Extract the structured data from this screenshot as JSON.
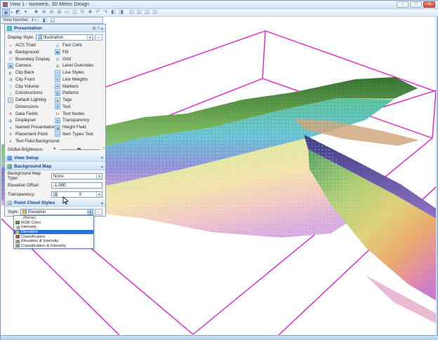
{
  "window": {
    "title": "View 1 - Isometric, 3D Metric Design",
    "minimize_label": "–",
    "maximize_label": "□",
    "close_label": "✕"
  },
  "toolbar": {
    "icons": [
      {
        "name": "view-attributes-icon",
        "glyph": "▣",
        "sel": true
      },
      {
        "name": "view-attributes-caret-icon",
        "glyph": "▾",
        "caret": true
      },
      {
        "name": "view-display-mode-icon",
        "glyph": "◩"
      },
      {
        "name": "adjust-view-brightness-icon",
        "glyph": "✦"
      },
      {
        "name": "separator",
        "sep": true
      },
      {
        "name": "update-view-icon",
        "glyph": "✚"
      },
      {
        "name": "zoom-in-icon",
        "glyph": "⊕"
      },
      {
        "name": "zoom-out-icon",
        "glyph": "⊖"
      },
      {
        "name": "window-area-icon",
        "glyph": "⊞"
      },
      {
        "name": "fit-view-icon",
        "glyph": "▭"
      },
      {
        "name": "copy-view-icon",
        "glyph": "◫"
      },
      {
        "name": "rotate-view-icon",
        "glyph": "↻"
      },
      {
        "name": "pan-view-icon",
        "glyph": "✥"
      },
      {
        "name": "view-previous-icon",
        "glyph": "↶"
      },
      {
        "name": "view-next-icon",
        "glyph": "↷"
      },
      {
        "name": "apply-window-1-icon",
        "glyph": "◧"
      },
      {
        "name": "apply-window-2-icon",
        "glyph": "◨"
      },
      {
        "name": "separator",
        "sep": true
      },
      {
        "name": "clip-volume-icon",
        "glyph": "◰"
      },
      {
        "name": "clip-mask-icon",
        "glyph": "◱"
      },
      {
        "name": "camera-settings-icon",
        "glyph": "◲"
      },
      {
        "name": "navigate-view-icon",
        "glyph": "◳"
      }
    ],
    "view_number_label": "View Number:",
    "view_number_value": "1",
    "view_number_caret": "▾",
    "view_group_icons": [
      {
        "name": "show-view-toggle-icon",
        "glyph": "◧"
      },
      {
        "name": "manage-view-groups-icon",
        "glyph": "◱"
      }
    ]
  },
  "panel": {
    "title": "Presentation",
    "header_icons": [
      {
        "name": "panel-grid-view-icon",
        "glyph": "⊞"
      },
      {
        "name": "panel-list-view-icon",
        "glyph": "≡"
      },
      {
        "name": "panel-collapse-icon",
        "glyph": "▴"
      }
    ],
    "display_style_label": "Display Style:",
    "display_style_value": "Illustration",
    "display_style_caret": "▾",
    "more_button_label": "...",
    "left_items": [
      {
        "label": "ACS Triad",
        "icon": "acs-triad-icon",
        "glyph": "✛",
        "color": "#c07020",
        "enabled": false
      },
      {
        "label": "Background",
        "icon": "background-icon",
        "glyph": "▦",
        "color": "#7090b0",
        "enabled": false
      },
      {
        "label": "Boundary Display",
        "icon": "boundary-display-icon",
        "glyph": "◳",
        "color": "#7090b0",
        "enabled": false
      },
      {
        "label": "Camera",
        "icon": "camera-icon",
        "glyph": "▣",
        "color": "#4878b8",
        "enabled": true
      },
      {
        "label": "Clip Back",
        "icon": "clip-back-icon",
        "glyph": "◧",
        "color": "#8098b0",
        "enabled": false
      },
      {
        "label": "Clip Front",
        "icon": "clip-front-icon",
        "glyph": "◨",
        "color": "#8098b0",
        "enabled": false
      },
      {
        "label": "Clip Volume",
        "icon": "clip-volume-icon",
        "glyph": "◰",
        "color": "#8098b0",
        "enabled": false
      },
      {
        "label": "Constructions",
        "icon": "constructions-icon",
        "glyph": "△",
        "color": "#6888a8",
        "enabled": false
      },
      {
        "label": "Default Lighting",
        "icon": "default-lighting-icon",
        "glyph": "☀",
        "color": "#d8a020",
        "enabled": true
      },
      {
        "label": "Dimensions",
        "icon": "dimensions-icon",
        "glyph": "↔",
        "color": "#3060a0",
        "enabled": false
      },
      {
        "label": "Data Fields",
        "icon": "data-fields-icon",
        "glyph": "A",
        "color": "#c03030",
        "enabled": false
      },
      {
        "label": "Displayset",
        "icon": "displayset-icon",
        "glyph": "▤",
        "color": "#5080b0",
        "enabled": false
      },
      {
        "label": "Named Presentation",
        "icon": "named-presentation-icon",
        "glyph": "★",
        "color": "#8080a0",
        "enabled": false
      },
      {
        "label": "Placement Point",
        "icon": "placement-point-icon",
        "glyph": "✛",
        "color": "#3050a0",
        "enabled": false
      },
      {
        "label": "Text Field Background",
        "icon": "text-field-background-icon",
        "glyph": "a",
        "color": "#444444",
        "enabled": false
      }
    ],
    "right_items": [
      {
        "label": "Fast Cells",
        "icon": "fast-cells-icon",
        "glyph": "⊞",
        "color": "#80a0c8",
        "enabled": false
      },
      {
        "label": "Fill",
        "icon": "fill-icon",
        "glyph": "◼",
        "color": "#3878c0",
        "enabled": true
      },
      {
        "label": "Grid",
        "icon": "grid-icon",
        "glyph": "▦",
        "color": "#9ab0c8",
        "enabled": false
      },
      {
        "label": "Level Overrides",
        "icon": "level-overrides-icon",
        "glyph": "▤",
        "color": "#50a050",
        "enabled": false
      },
      {
        "label": "Line Styles",
        "icon": "line-styles-icon",
        "glyph": "≈",
        "color": "#3060a0",
        "enabled": true
      },
      {
        "label": "Line Weights",
        "icon": "line-weights-icon",
        "glyph": "≡",
        "color": "#204880",
        "enabled": true
      },
      {
        "label": "Markers",
        "icon": "markers-icon",
        "glyph": "▼",
        "color": "#3878c0",
        "enabled": true
      },
      {
        "label": "Patterns",
        "icon": "patterns-icon",
        "glyph": "▨",
        "color": "#5080b0",
        "enabled": true
      },
      {
        "label": "Tags",
        "icon": "tags-icon",
        "glyph": "◆",
        "color": "#e08020",
        "enabled": true
      },
      {
        "label": "Text",
        "icon": "text-icon",
        "glyph": "A",
        "color": "#2858a8",
        "enabled": true
      },
      {
        "label": "Text Nodes",
        "icon": "text-nodes-icon",
        "glyph": "1+",
        "color": "#c03030",
        "enabled": false
      },
      {
        "label": "Transparency",
        "icon": "transparency-icon",
        "glyph": "▥",
        "color": "#6090c0",
        "enabled": true
      },
      {
        "label": "Height Field",
        "icon": "height-field-icon",
        "glyph": "◪",
        "color": "#5080b0",
        "enabled": true
      },
      {
        "label": "Item Types Text",
        "icon": "item-types-text-icon",
        "glyph": "▭",
        "color": "#5080b0",
        "enabled": true
      }
    ],
    "global_brightness_label": "Global Brightness:",
    "view_setup": {
      "title": "View Setup",
      "collapse_glyph": "▾"
    },
    "background_map": {
      "title": "Background Map",
      "collapse_glyph": "▴",
      "type_label": "Background Map Type:",
      "type_value": "None",
      "elevation_label": "Elevation Offset:",
      "elevation_value": "-1.000",
      "transparency_label": "Transparency:",
      "transparency_value": "0"
    },
    "point_cloud": {
      "title": "Point Cloud Styles",
      "collapse_glyph": "▴",
      "style_label": "Style:",
      "style_value": "Elevation",
      "options": [
        {
          "label": "(None)",
          "icon": "",
          "none": true
        },
        {
          "label": "RGB Color",
          "icon": "rgb-color-icon",
          "grad": "linear-gradient(90deg,#d04040,#40a040,#4060d0)"
        },
        {
          "label": "Intensity",
          "icon": "intensity-icon",
          "grad": "linear-gradient(90deg,#e8e8e8,#808080)"
        },
        {
          "label": "Elevation",
          "icon": "elevation-icon",
          "grad": "linear-gradient(90deg,#e08030,#d8d050,#4090d0)",
          "selected": true
        },
        {
          "label": "Classification",
          "icon": "classification-icon",
          "grad": "linear-gradient(90deg,#50a050,#c05050,#5050c0)"
        },
        {
          "label": "Elevation & Intensity",
          "icon": "elevation-intensity-icon",
          "grad": "linear-gradient(90deg,#e0a050,#909090,#5090c0)"
        },
        {
          "label": "Classification & Intensity",
          "icon": "classification-intensity-icon",
          "grad": "linear-gradient(90deg,#70a070,#a0a0a0,#7070b0)"
        }
      ]
    }
  },
  "colors": {
    "wireframe_magenta": "#e01ed0",
    "selection_blue": "#2a6fd6",
    "section_header_text": "#16407e",
    "close_button_red": "#cf5148"
  }
}
